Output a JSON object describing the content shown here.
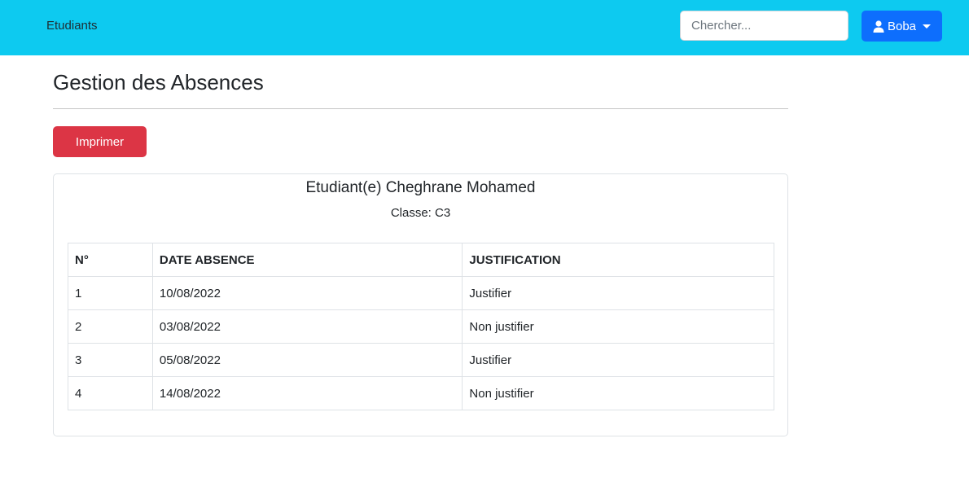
{
  "navbar": {
    "brand": "Etudiants",
    "search_placeholder": "Chercher...",
    "user_label": "Boba"
  },
  "page": {
    "title": "Gestion des Absences",
    "print_label": "Imprimer"
  },
  "student": {
    "name": "Etudiant(e) Cheghrane Mohamed",
    "class": "Classe: C3"
  },
  "table": {
    "headers": [
      "N°",
      "DATE ABSENCE",
      "JUSTIFICATION"
    ],
    "rows": [
      [
        "1",
        "10/08/2022",
        "Justifier"
      ],
      [
        "2",
        "03/08/2022",
        "Non justifier"
      ],
      [
        "3",
        "05/08/2022",
        "Justifier"
      ],
      [
        "4",
        "14/08/2022",
        "Non justifier"
      ]
    ]
  },
  "colors": {
    "navbar": "#0dcaf0",
    "user_button": "#0d6efd",
    "print_button": "#dc3545"
  },
  "icons": {
    "user": "user-icon",
    "caret": "chevron-down-icon"
  }
}
